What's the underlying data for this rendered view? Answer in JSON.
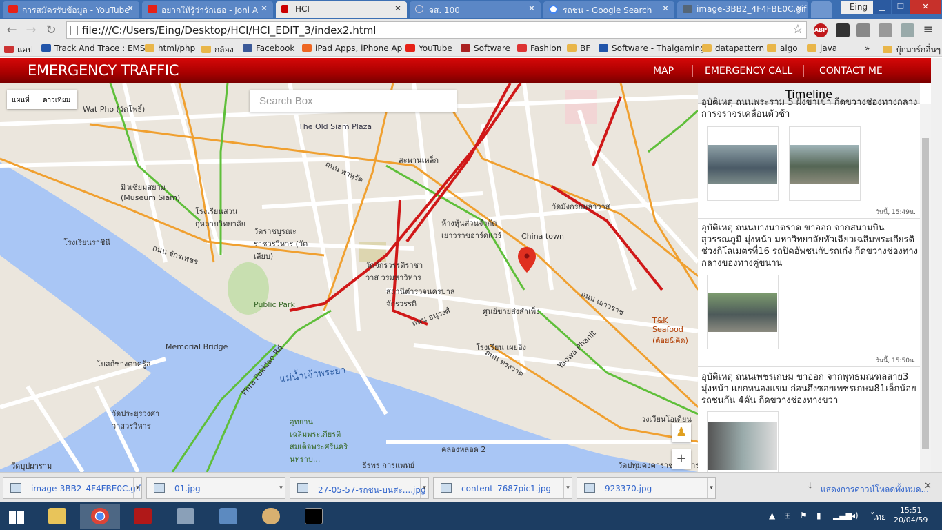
{
  "browser": {
    "tabs": [
      {
        "title": "การสมัครรับข้อมูล - YouTube",
        "color": "#e62117"
      },
      {
        "title": "อยากให้รู้ว่ารักเธอ - Joni A",
        "color": "#e62117"
      },
      {
        "title": "HCI",
        "color": "#cc0000"
      },
      {
        "title": "จส. 100",
        "color": "#888888"
      },
      {
        "title": "รถชน - Google Search",
        "color": "#4285f4"
      },
      {
        "title": "image-3BB2_4F4FBE0C.gif",
        "color": "#556677"
      }
    ],
    "user": "Eing",
    "url": "file:///C:/Users/Eing/Desktop/HCI/HCI_EDIT_3/index2.html",
    "bookmarks": [
      {
        "label": "แอป",
        "color": "#c33"
      },
      {
        "label": "Track And Trace : EMS",
        "color": "#2255aa"
      },
      {
        "label": "html/php",
        "color": "#e9b64a"
      },
      {
        "label": "กล้อง",
        "color": "#e9b64a"
      },
      {
        "label": "Facebook",
        "color": "#3b5998"
      },
      {
        "label": "iPad Apps, iPhone Ap",
        "color": "#ee6622"
      },
      {
        "label": "YouTube",
        "color": "#e62117"
      },
      {
        "label": "Software",
        "color": "#aa2222"
      },
      {
        "label": "Fashion",
        "color": "#dd3333"
      },
      {
        "label": "BF",
        "color": "#e9b64a"
      },
      {
        "label": "Software - Thaigaming",
        "color": "#2255aa"
      },
      {
        "label": "datapattern",
        "color": "#e9b64a"
      },
      {
        "label": "algo",
        "color": "#e9b64a"
      },
      {
        "label": "java",
        "color": "#e9b64a"
      },
      {
        "label": "บุ๊กมาร์กอื่นๆ",
        "color": "#e9b64a"
      }
    ]
  },
  "site": {
    "title": "EMERGENCY TRAFFIC",
    "nav": [
      "MAP",
      "EMERGENCY CALL",
      "CONTACT ME"
    ]
  },
  "map": {
    "type_map": "แผนที่",
    "type_satellite": "ดาวเทียม",
    "search_placeholder": "Search Box",
    "labels": [
      "Wat Pho (วัดโพธิ์)",
      "The Old Siam Plaza",
      "สะพานเหล็ก",
      "มิวเซียมสยาม (Museum Siam)",
      "โรงเรียนสวนกุหลาบวิทยาลัย",
      "วัดราชบูรณะราชวรวิหาร (วัดเลียบ)",
      "โรงเรียนราชินี",
      "วัดจักรวรรดิราชาวาส วรมหาวิหาร",
      "สถานีตำรวจนครบาลจักรวรรดิ",
      "Public Park",
      "ห้างหุ้นส่วนจำกัดเยาวราชฮาร์ดแวร์",
      "China town",
      "วัดมังกรกมลาวาส",
      "ศูนย์ขายส่งสำเพ็ง",
      "โรงเรียน เผยอิง",
      "T&K Seafood (ต้อย&คิด)",
      "Yaowa Phanit",
      "Memorial Bridge",
      "Phra Pokklao Rd",
      "แม่น้ำเจ้าพระยา",
      "วัดประยุรวงศาวาสวรวิหาร",
      "อุทยานเฉลิมพระเกียรติสมเด็จพระศรีนครินทราบ...",
      "คลองหลอด 2",
      "ธีรพร การแพทย์",
      "วัดปทุมคงคาราชวรวิหาร",
      "วงเวียนโอเดียน",
      "โบสถ์ซางตาครู้ส",
      "วัดบุปผาราม",
      "ถนน จักรเพชร",
      "ถนน อนุวงศ์",
      "ถนน ทรงวาด",
      "ถนน เยาวราช",
      "ถนน พาหุรัด"
    ]
  },
  "timeline": {
    "title": "Timeline",
    "posts": [
      {
        "text": "อุบัติเหตุ ถนนพระราม 5 ฝั่งขาเข้า กีดขวางช่องทางกลาง การจราจรเคลื่อนตัวช้า",
        "time": "วันนี้, 15:49น."
      },
      {
        "text": "อุบัติเหตุ ถนนบางนาตราด ขาออก จากสนามบินสุวรรณภูมิ มุ่งหน้า มหาวิทยาลัยหัวเฉียวเฉลิมพระเกียรติ ช่วงกิโลเมตรที่16 รถปิคอัพชนกับรถเก๋ง กีดขวางช่องทางกลางของทางคู่ขนาน",
        "time": "วันนี้, 15:50น."
      },
      {
        "text": "อุบัติเหตุ ถนนเพชรเกษม ขาออก จากพุทธมณฑลสาย3 มุ่งหน้า แยกหนองแขม ก่อนถึงซอยเพชรเกษม81เล็กน้อย รถชนกัน 4คัน กีดขวางช่องทางขวา",
        "time": ""
      }
    ]
  },
  "downloads": {
    "items": [
      "image-3BB2_4F4FBE0C.gif",
      "01.jpg",
      "27-05-57-รถชน-บนสะ....jpg",
      "content_7687pic1.jpg",
      "923370.jpg"
    ],
    "show_all": "แสดงการดาวน์โหลดทั้งหมด..."
  },
  "taskbar": {
    "lang": "ไทย",
    "time": "15:51",
    "date": "20/04/59"
  }
}
